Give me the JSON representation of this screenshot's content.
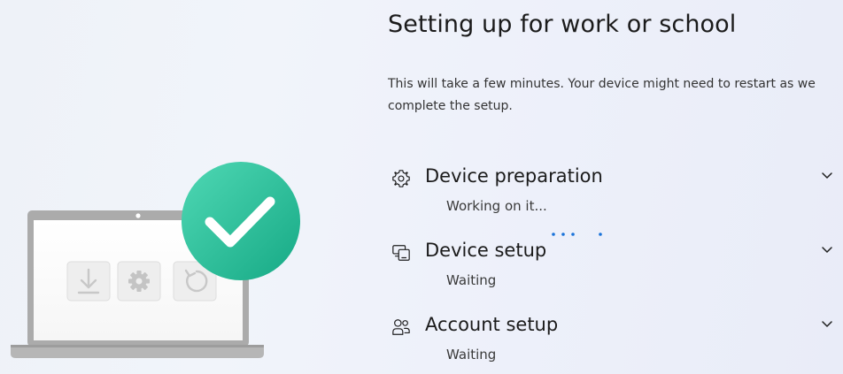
{
  "main": {
    "title": "Setting up for work or school",
    "description_line1": "This will take a few minutes. Your device might need to restart as we",
    "description_line2": "complete the setup."
  },
  "steps": [
    {
      "icon": "gear-icon",
      "title": "Device preparation",
      "status": "Working on it...",
      "in_progress": true
    },
    {
      "icon": "device-setup-icon",
      "title": "Device setup",
      "status": "Waiting",
      "in_progress": false
    },
    {
      "icon": "people-icon",
      "title": "Account setup",
      "status": "Waiting",
      "in_progress": false
    }
  ],
  "colors": {
    "accent": "#1a73d9",
    "check_circle": "#2fc19d",
    "laptop_body": "#a9a9a9"
  },
  "illustration": {
    "icons": [
      "download-icon",
      "settings-icon",
      "restart-icon",
      "checkmark-icon"
    ]
  }
}
